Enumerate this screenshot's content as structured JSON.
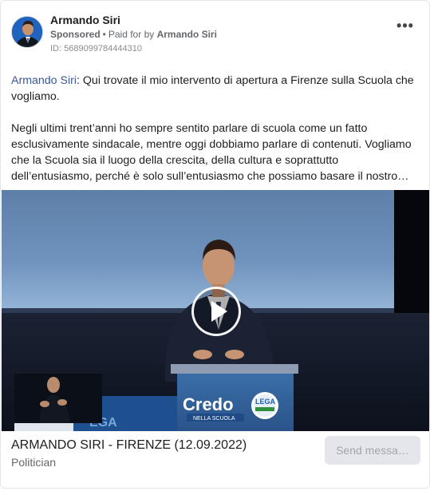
{
  "advertiser": {
    "name": "Armando Siri",
    "sponsored_label": "Sponsored",
    "paid_for_prefix": "Paid for by",
    "paid_for_name": "Armando Siri",
    "ad_id": "ID: 5689099784444310"
  },
  "post": {
    "author_link": "Armando Siri",
    "intro": ": Qui trovate il mio intervento di apertura a Firenze sulla Scuola che vogliamo.",
    "paragraph2": "Negli ultimi trent’anni ho sempre sentito parlare di scuola come un fatto esclusivamente sindacale, mentre oggi dobbiamo parlare di contenuti. Vogliamo che la Scuola sia il luogo della crescita, della cultura e soprattutto dell’entusiasmo, perché è solo sull’entusiasmo che possiamo basare il nostro…"
  },
  "video": {
    "podium_text": "Credo",
    "podium_subtext": "NELLA SCUOLA",
    "logo_text": "LEGA"
  },
  "footer": {
    "title": "ARMANDO SIRI - FIRENZE (12.09.2022)",
    "subtitle": "Politician",
    "button_label": "Send messa…"
  },
  "icons": {
    "more": "more-options-icon",
    "play": "play-icon"
  }
}
